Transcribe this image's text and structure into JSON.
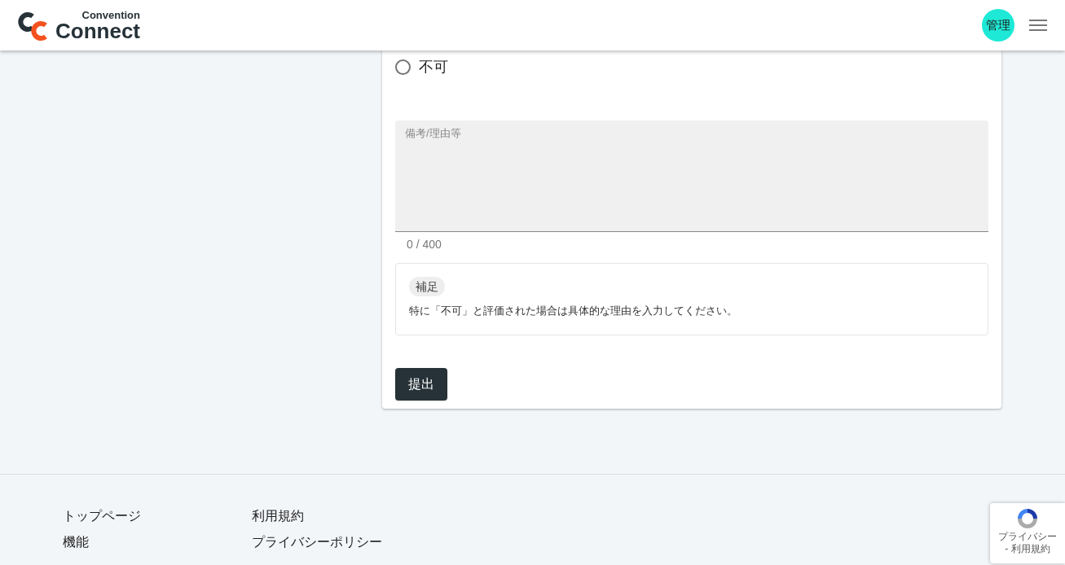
{
  "header": {
    "logo_small": "Convention",
    "logo_large": "Connect",
    "avatar": "管理"
  },
  "form": {
    "radio_options": [
      {
        "label": "不可",
        "selected": false
      }
    ],
    "remarks": {
      "placeholder": "備考/理由等",
      "counter": "0 / 400"
    },
    "note": {
      "badge": "補足",
      "text": "特に「不可」と評価された場合は具体的な理由を入力してください。"
    },
    "submit": "提出"
  },
  "footer": {
    "columns": [
      [
        "トップページ",
        "機能"
      ],
      [
        "利用規約",
        "プライバシーポリシー"
      ]
    ]
  },
  "recaptcha": {
    "links": [
      "プライバシー",
      "- 利用規約"
    ]
  }
}
